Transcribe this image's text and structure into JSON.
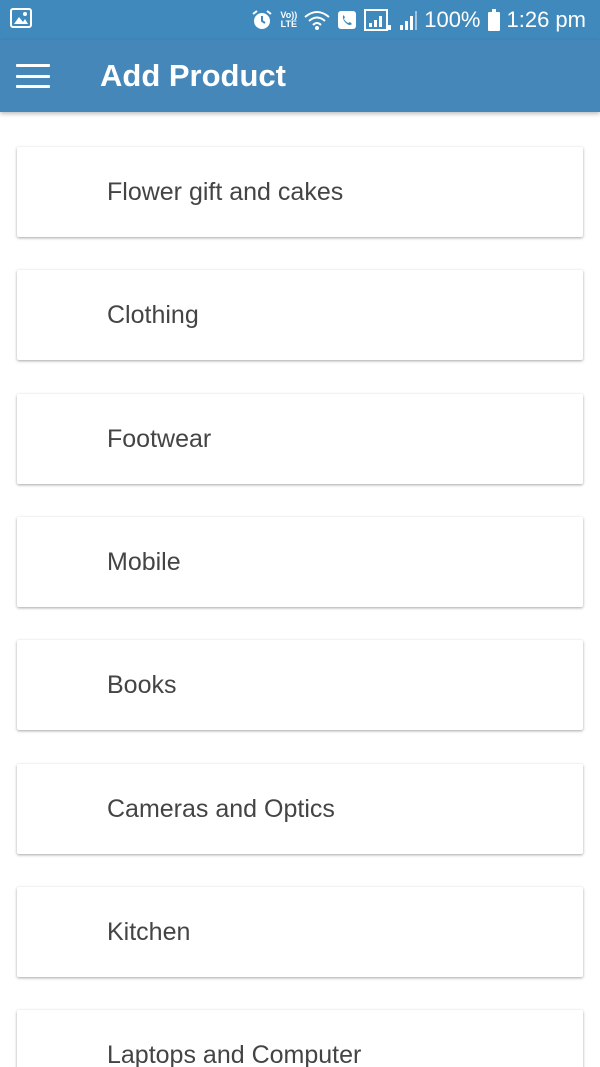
{
  "status_bar": {
    "battery_text": "100%",
    "time": "1:26 pm",
    "volte_top": "Vo))",
    "volte_bottom": "LTE",
    "icons": [
      "image-icon",
      "alarm-icon",
      "volte-icon",
      "wifi-icon",
      "wifi-calling-icon",
      "signal-icon",
      "signal-icon",
      "battery-icon"
    ]
  },
  "app_bar": {
    "title": "Add Product",
    "menu_icon": "hamburger-menu-icon"
  },
  "categories": [
    {
      "label": "Flower gift and cakes"
    },
    {
      "label": "Clothing"
    },
    {
      "label": "Footwear"
    },
    {
      "label": "Mobile"
    },
    {
      "label": "Books"
    },
    {
      "label": "Cameras and Optics"
    },
    {
      "label": "Kitchen"
    },
    {
      "label": "Laptops and Computer"
    }
  ],
  "colors": {
    "status_bar": "#3f89bd",
    "app_bar": "#4587b8",
    "text": "#444444",
    "background": "#ffffff"
  }
}
